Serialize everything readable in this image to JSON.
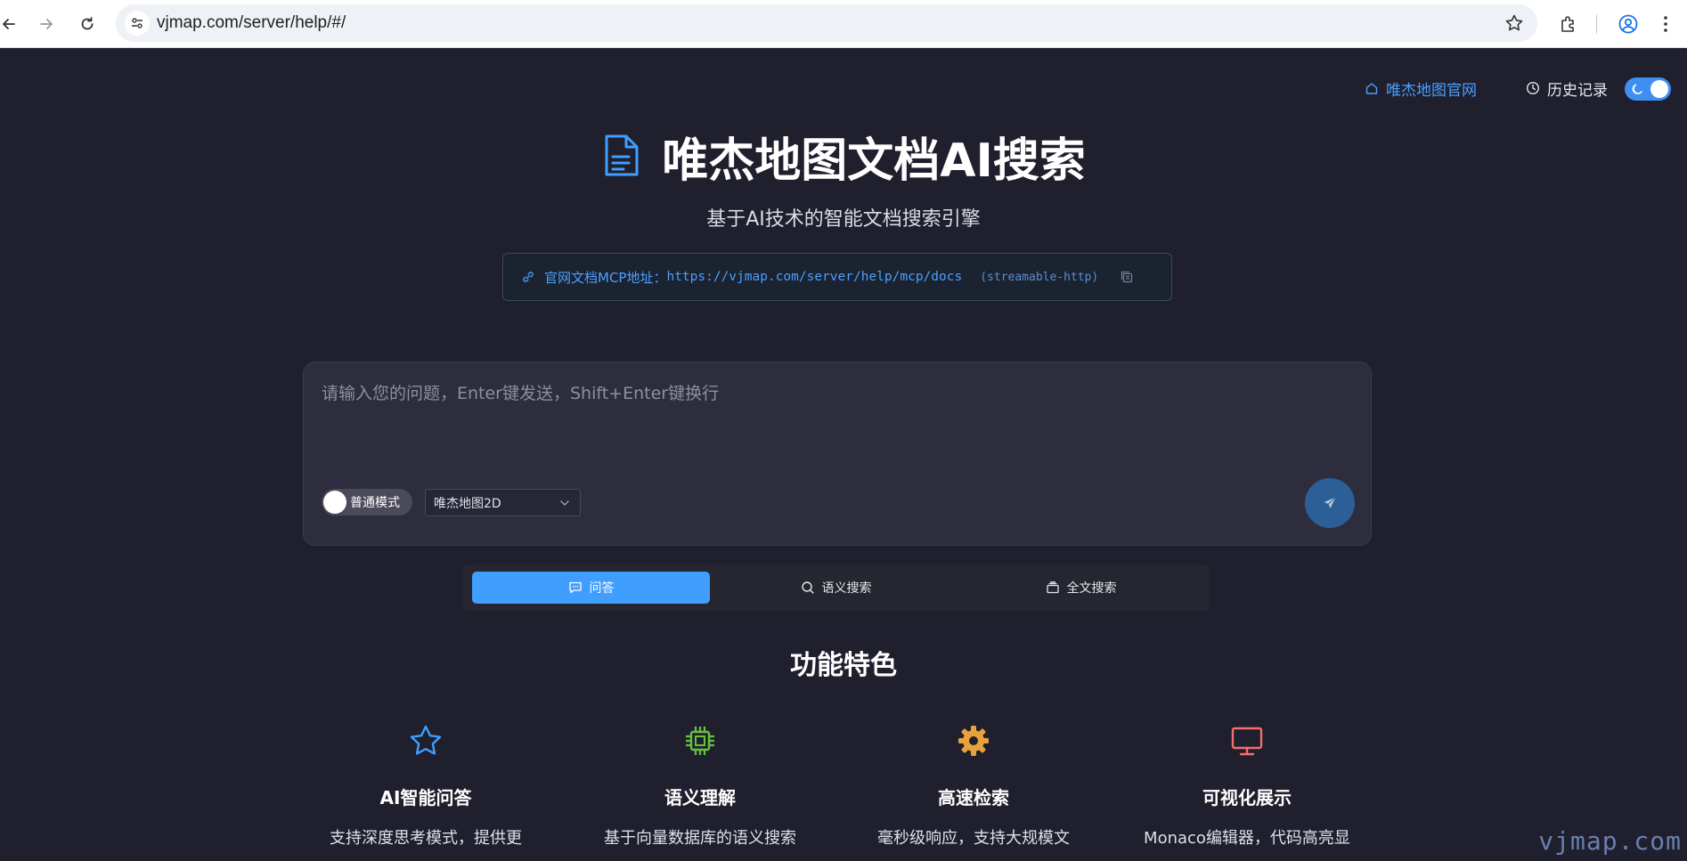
{
  "browser": {
    "url": "vjmap.com/server/help/#/"
  },
  "header": {
    "home_link": "唯杰地图官网",
    "history_link": "历史记录"
  },
  "hero": {
    "title": "唯杰地图文档AI搜索",
    "subtitle": "基于AI技术的智能文档搜索引擎",
    "mcp_label": "官网文档MCP地址：",
    "mcp_url": "https://vjmap.com/server/help/mcp/docs",
    "mcp_protocol": "(streamable-http)"
  },
  "search": {
    "placeholder": "请输入您的问题，Enter键发送，Shift+Enter键换行",
    "mode_label": "普通模式",
    "selected_source": "唯杰地图2D"
  },
  "tabs": [
    {
      "label": "问答",
      "icon": "chat-icon",
      "active": true
    },
    {
      "label": "语义搜索",
      "icon": "search-icon",
      "active": false
    },
    {
      "label": "全文搜索",
      "icon": "archive-icon",
      "active": false
    }
  ],
  "features": {
    "title": "功能特色",
    "items": [
      {
        "title": "AI智能问答",
        "desc": "支持深度思考模式，提供更",
        "icon": "star-icon",
        "color": "#409eff"
      },
      {
        "title": "语义理解",
        "desc": "基于向量数据库的语义搜索",
        "icon": "chip-icon",
        "color": "#67c23a"
      },
      {
        "title": "高速检索",
        "desc": "毫秒级响应，支持大规模文",
        "icon": "gear-icon",
        "color": "#e6a23c"
      },
      {
        "title": "可视化展示",
        "desc": "Monaco编辑器，代码高亮显",
        "icon": "monitor-icon",
        "color": "#f56c6c"
      }
    ]
  },
  "watermark": "vjmap.com",
  "colors": {
    "accent": "#409eff",
    "background": "#1f1f2d"
  }
}
